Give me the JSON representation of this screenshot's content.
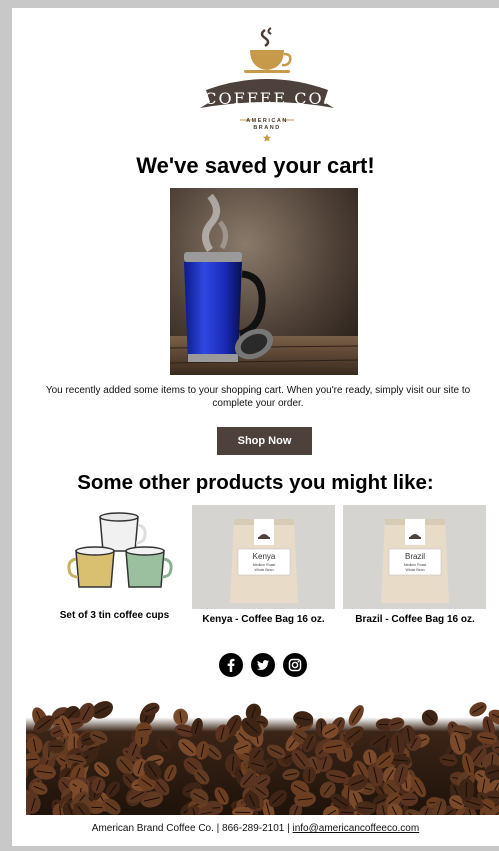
{
  "logo": {
    "name": "COFFEE CO.",
    "tagline_line1": "AMERICAN",
    "tagline_line2": "BRAND"
  },
  "headline": "We've saved your cart!",
  "intro_text": "You recently added some items to your shopping cart. When you're ready, simply visit our site to complete your order.",
  "cta_label": "Shop Now",
  "recommendations_title": "Some other products you might like:",
  "products": [
    {
      "name": "Set of 3 tin coffee cups"
    },
    {
      "name": "Kenya - Coffee Bag 16 oz.",
      "bag_label": "Kenya",
      "bag_sub1": "Medium Roast",
      "bag_sub2": "Whole Bean"
    },
    {
      "name": "Brazil - Coffee Bag 16 oz.",
      "bag_label": "Brazil",
      "bag_sub1": "Medium Roast",
      "bag_sub2": "Whole Bean"
    }
  ],
  "social": [
    "facebook-icon",
    "twitter-icon",
    "instagram-icon"
  ],
  "footer": {
    "text": "American Brand Coffee Co. | 866-289-2101 | ",
    "email": "info@americancoffeeco.com"
  },
  "colors": {
    "brand_brown": "#4e403a",
    "logo_gold": "#c79a4a"
  }
}
